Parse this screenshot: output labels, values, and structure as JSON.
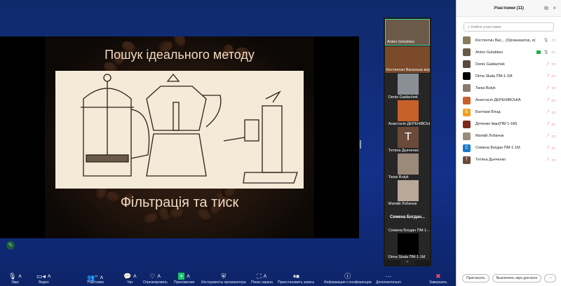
{
  "slide": {
    "title": "Пошук ідеального методу",
    "subtitle": "Фільтрація та тиск"
  },
  "video_strip": [
    {
      "name": "Anton Golubkov",
      "muted": false,
      "color": "#6b5a4a"
    },
    {
      "name": "Костянтин Васильєв внук...",
      "muted": false,
      "color": "#7a4a2a"
    },
    {
      "name": "Denis Gaidachek",
      "muted": true,
      "color": "#8a8f96"
    },
    {
      "name": "Анастасія ДЕРЕНІВСЬКА",
      "muted": true,
      "color": "#c8602a"
    },
    {
      "name": "Тетяна Дьяченко",
      "muted": true,
      "avatar": "T",
      "color": "#6b4a3a"
    },
    {
      "name": "Taras Butyk",
      "muted": true,
      "color": "#9a8a7a"
    },
    {
      "name": "Матвій Лобачов",
      "muted": true,
      "color": "#b8a898"
    },
    {
      "name": "Семена Богдан ПМ-1-...",
      "muted": true,
      "heading": "Семена  Богдан..."
    },
    {
      "name": "Dima Skala ПМ-1-1М",
      "muted": true,
      "color": "#000"
    }
  ],
  "panel": {
    "title": "Участники (11)",
    "search_placeholder": "Найти участника",
    "participants": [
      {
        "name": "Костянтин Вас...  (Организатор, я)",
        "color": "#8a7a5a",
        "mic": "on"
      },
      {
        "name": "Anton Golubkov",
        "color": "#6b5a4a",
        "mic": "on"
      },
      {
        "name": "Denis Gaidachek",
        "color": "#5a4a3a",
        "mic": "off"
      },
      {
        "name": "Dima Skala ПМ-1-1М",
        "color": "#000000",
        "mic": "off"
      },
      {
        "name": "Taras Butyk",
        "color": "#8a7a6a",
        "mic": "off"
      },
      {
        "name": "Анастасія ДЕРЕНІВСЬКА",
        "color": "#c8602a",
        "mic": "off"
      },
      {
        "name": "Балтаки Влад",
        "color": "#f0a020",
        "initial": "Б",
        "mic": "off"
      },
      {
        "name": "Дяченко Іван(ПМ 1-1М)",
        "color": "#7a2a1a",
        "mic": "off"
      },
      {
        "name": "Матвій Лобачов",
        "color": "#9a8a7a",
        "mic": "off"
      },
      {
        "name": "Семена Богдан ПМ-1-1М",
        "color": "#1a7ac8",
        "initial": "C",
        "mic": "off"
      },
      {
        "name": "Тетяна Дьяченко",
        "color": "#6b4a3a",
        "initial": "T",
        "mic": "off"
      }
    ],
    "invite": "Пригласить",
    "mute_all": "Выключить звук для всех",
    "more": "···"
  },
  "toolbar": {
    "audio": "Звук",
    "video": "Видео",
    "participants": "Участники",
    "participants_count": "11",
    "chat": "Чат",
    "react": "Отреагировать",
    "apps": "Приложения",
    "host_tools": "Инструменты организатора",
    "share": "Показ экрана",
    "pause_record": "Приостановить запись",
    "info": "Информация о конференции",
    "more": "Дополнительно",
    "end": "Завершить"
  }
}
